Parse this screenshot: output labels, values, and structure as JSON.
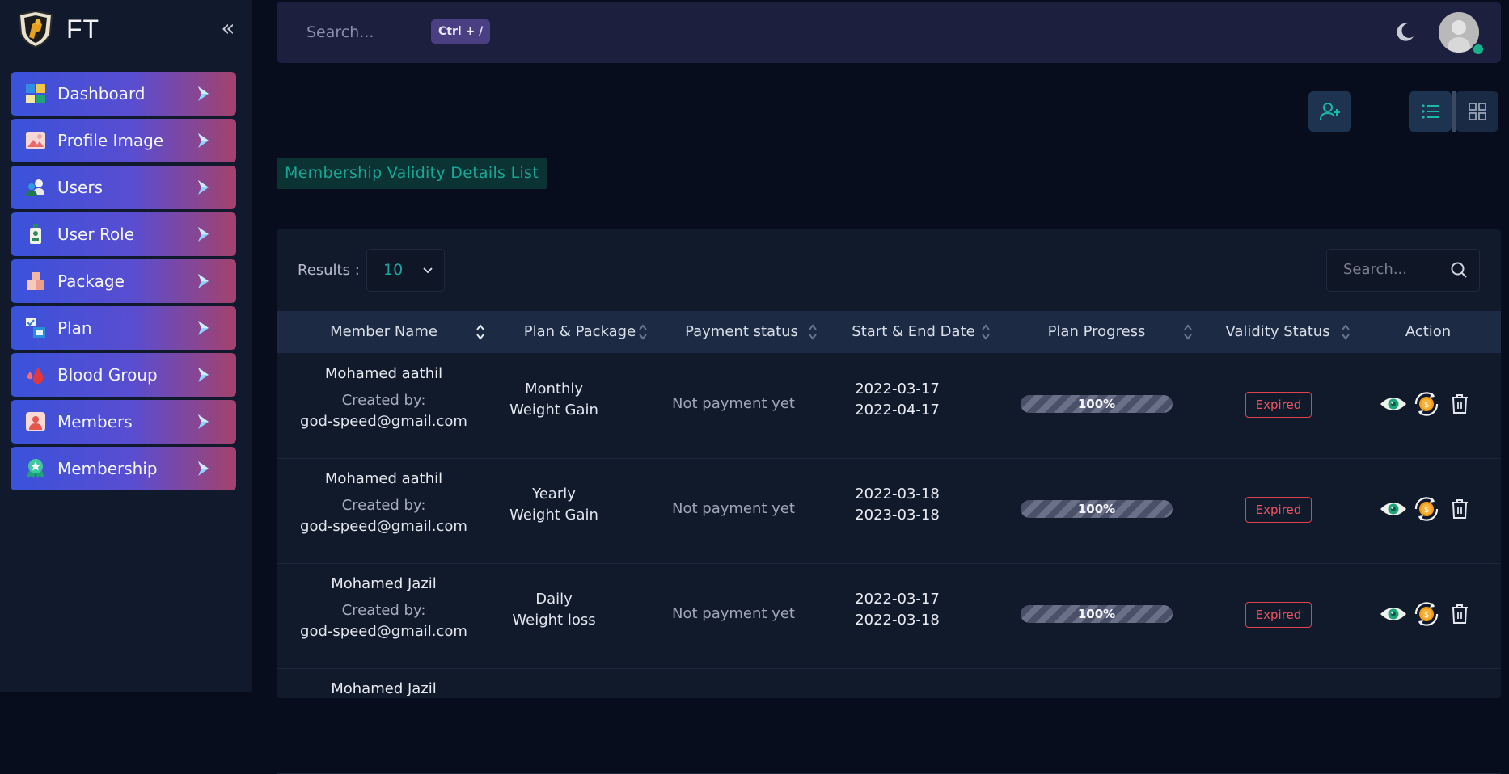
{
  "brand": {
    "name": "FT"
  },
  "sidebar": {
    "items": [
      {
        "label": "Dashboard",
        "icon": "dashboard-icon"
      },
      {
        "label": "Profile Image",
        "icon": "image-icon"
      },
      {
        "label": "Users",
        "icon": "users-icon"
      },
      {
        "label": "User Role",
        "icon": "badge-icon"
      },
      {
        "label": "Package",
        "icon": "package-icon"
      },
      {
        "label": "Plan",
        "icon": "plan-icon"
      },
      {
        "label": "Blood Group",
        "icon": "blood-drop-icon"
      },
      {
        "label": "Members",
        "icon": "member-icon"
      },
      {
        "label": "Membership",
        "icon": "award-icon"
      }
    ]
  },
  "topbar": {
    "search_placeholder": "Search...",
    "shortcut": "Ctrl + /"
  },
  "page": {
    "title": "Membership Validity Details List"
  },
  "table": {
    "results_label": "Results :",
    "results_value": "10",
    "search_placeholder": "Search...",
    "columns": [
      "Member Name",
      "Plan & Package",
      "Payment status",
      "Start & End Date",
      "Plan Progress",
      "Validity Status",
      "Action"
    ],
    "rows": [
      {
        "name": "Mohamed aathil",
        "created_label": "Created by:",
        "email": "god-speed@gmail.com",
        "plan": "Monthly",
        "package": "Weight Gain",
        "payment": "Not payment yet",
        "start": "2022-03-17",
        "end": "2022-04-17",
        "progress": "100%",
        "status": "Expired"
      },
      {
        "name": "Mohamed aathil",
        "created_label": "Created by:",
        "email": "god-speed@gmail.com",
        "plan": "Yearly",
        "package": "Weight Gain",
        "payment": "Not payment yet",
        "start": "2022-03-18",
        "end": "2023-03-18",
        "progress": "100%",
        "status": "Expired"
      },
      {
        "name": "Mohamed Jazil",
        "created_label": "Created by:",
        "email": "god-speed@gmail.com",
        "plan": "Daily",
        "package": "Weight loss",
        "payment": "Not payment yet",
        "start": "2022-03-17",
        "end": "2022-03-18",
        "progress": "100%",
        "status": "Expired"
      },
      {
        "name": "Mohamed Jazil"
      }
    ]
  },
  "colors": {
    "accent": "#17a895",
    "danger": "#e0424f",
    "sidebar_gradient_start": "#3a52db",
    "sidebar_gradient_end": "#a4426d"
  }
}
